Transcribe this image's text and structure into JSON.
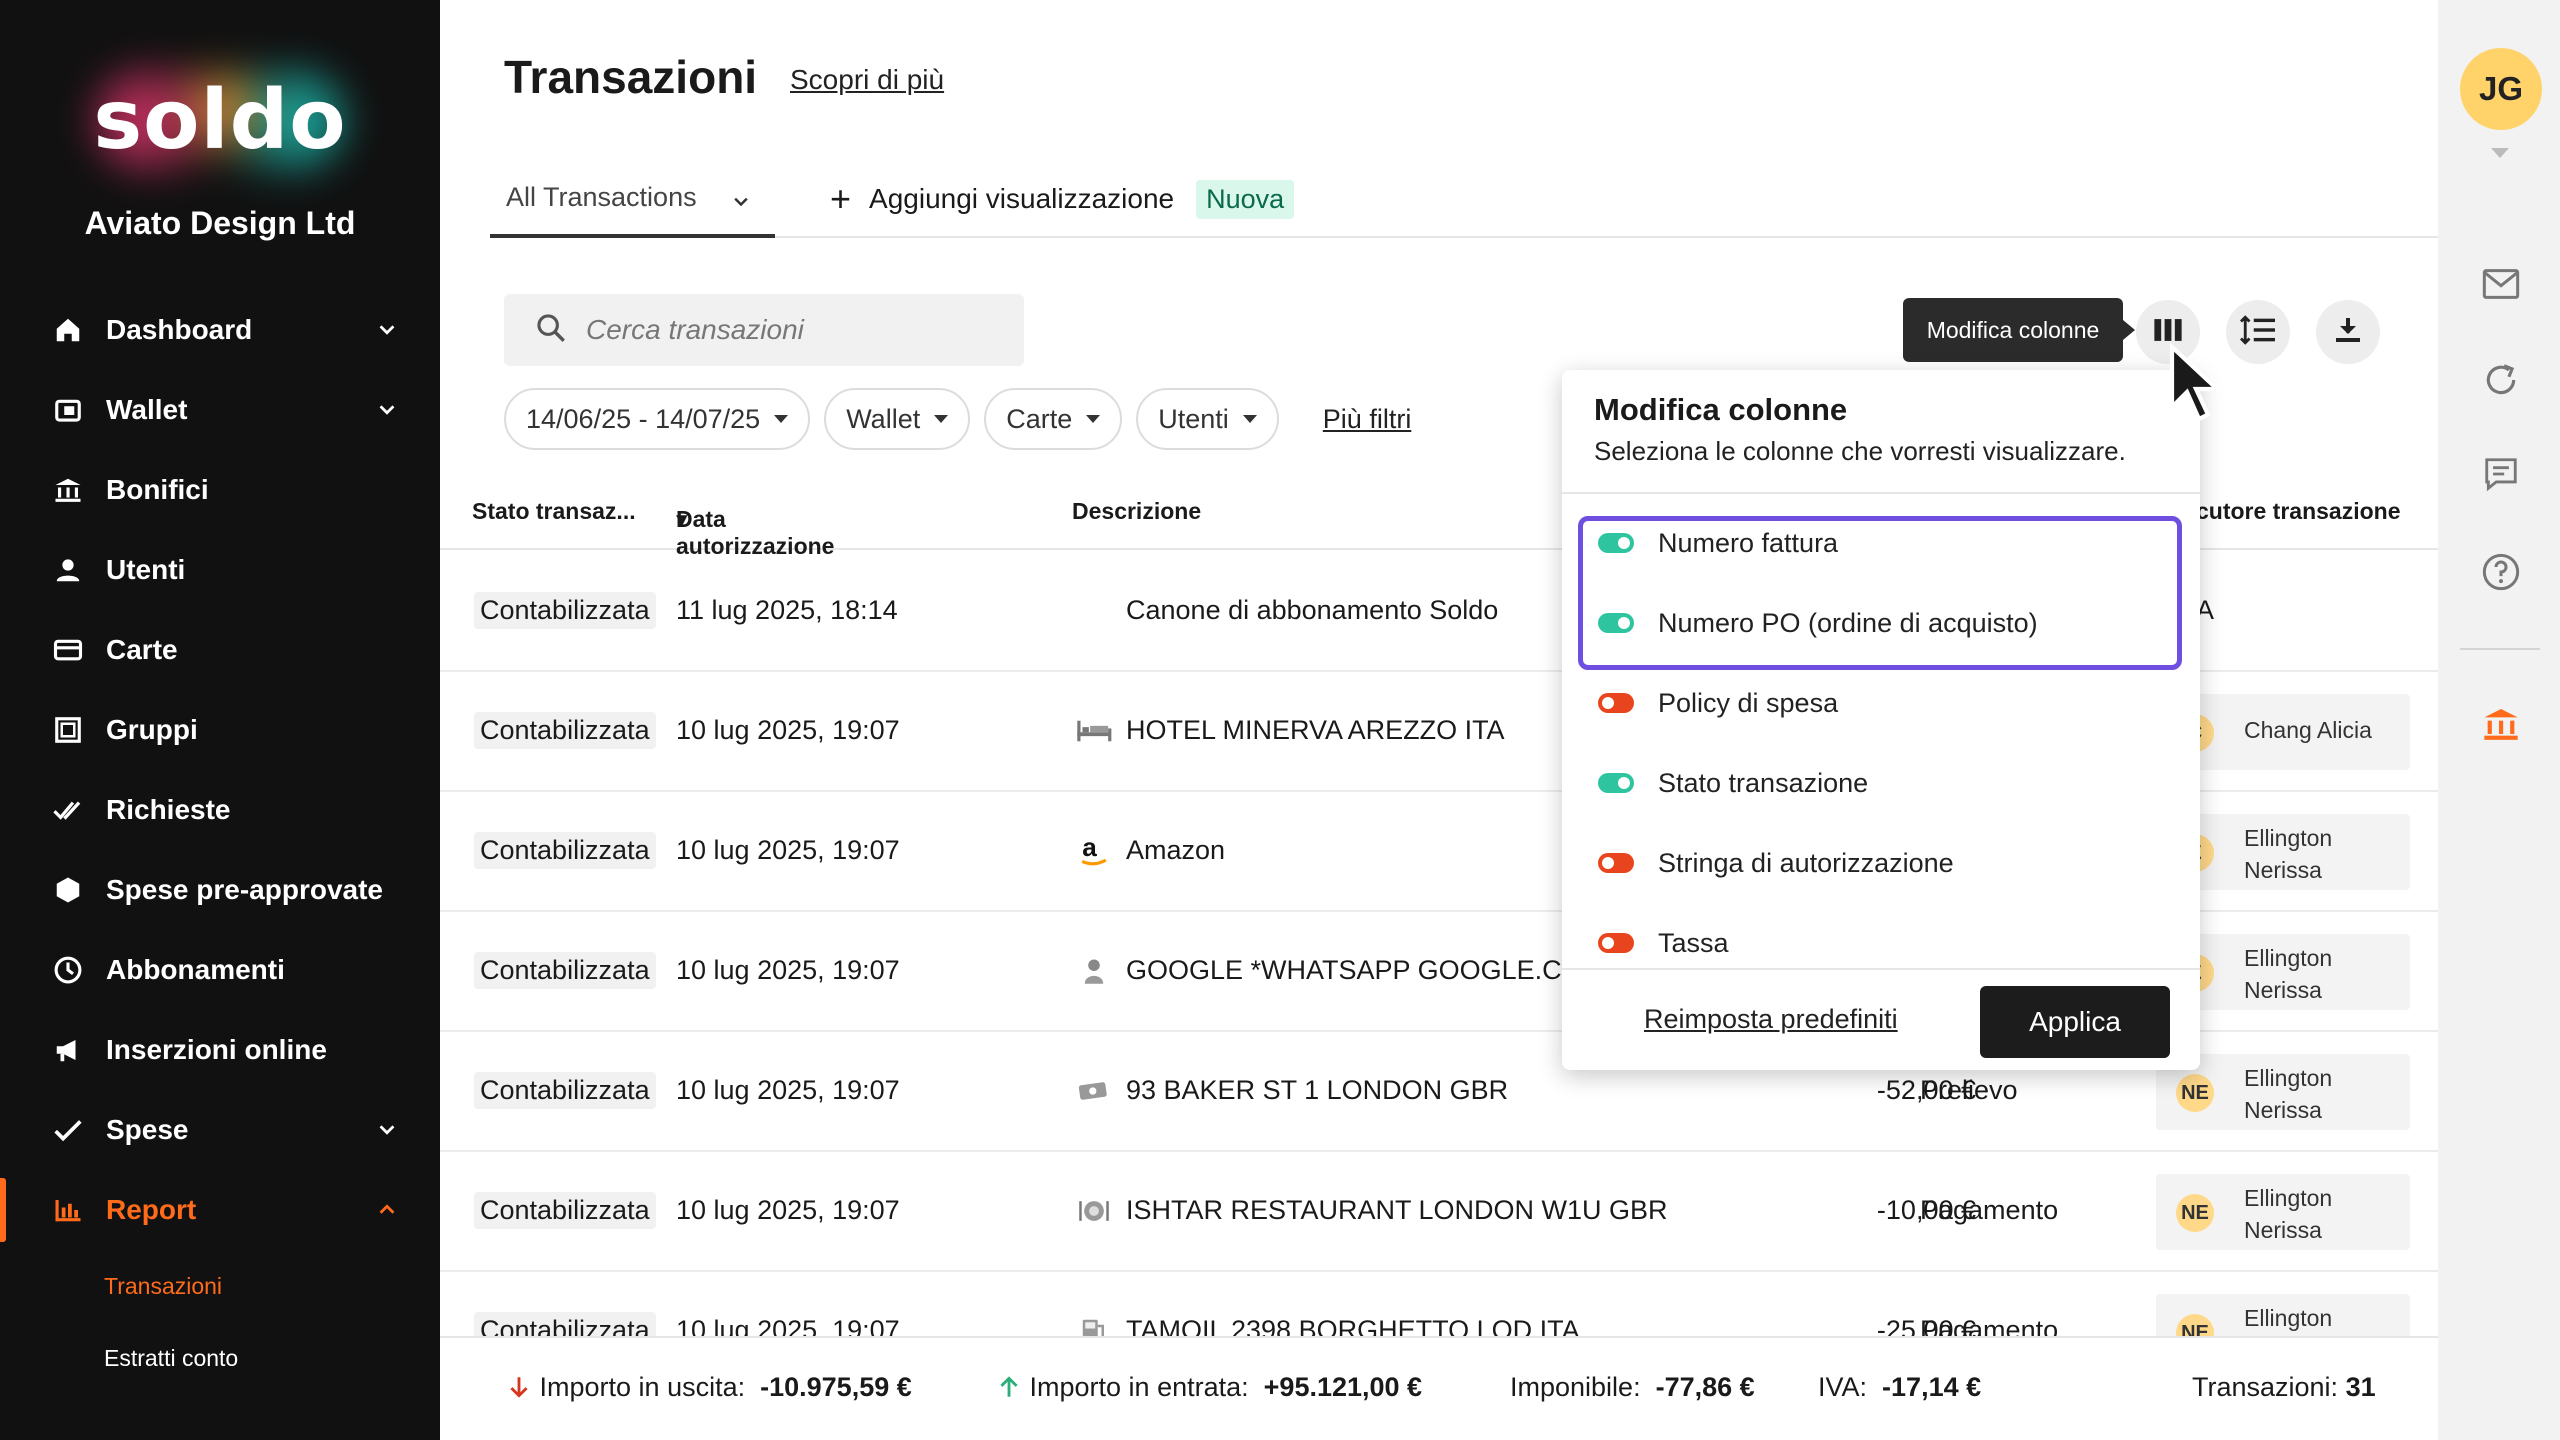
{
  "sidebar": {
    "logo_text": "soldo",
    "company": "Aviato Design Ltd",
    "items": [
      {
        "label": "Dashboard",
        "icon": "home-icon"
      },
      {
        "label": "Wallet",
        "icon": "wallet-icon"
      },
      {
        "label": "Bonifici",
        "icon": "bank-transfer-icon"
      },
      {
        "label": "Utenti",
        "icon": "user-icon"
      },
      {
        "label": "Carte",
        "icon": "card-icon"
      },
      {
        "label": "Gruppi",
        "icon": "groups-icon"
      },
      {
        "label": "Richieste",
        "icon": "requests-icon"
      },
      {
        "label": "Spese pre-approvate",
        "icon": "shield-icon"
      },
      {
        "label": "Abbonamenti",
        "icon": "clock-icon"
      },
      {
        "label": "Inserzioni online",
        "icon": "megaphone-icon"
      },
      {
        "label": "Spese",
        "icon": "check-icon"
      },
      {
        "label": "Report",
        "icon": "chart-icon"
      }
    ],
    "sub_items": [
      "Transazioni",
      "Estratti conto"
    ],
    "accent": "#ff6b1a"
  },
  "header": {
    "title": "Transazioni",
    "learn_more": "Scopri di più",
    "tab_all": "All Transactions",
    "add_view": "Aggiungi visualizzazione",
    "new_badge": "Nuova"
  },
  "search": {
    "placeholder": "Cerca transazioni"
  },
  "filters": {
    "date_range": "14/06/25 - 14/07/25",
    "wallet": "Wallet",
    "cards": "Carte",
    "users": "Utenti",
    "more": "Più filtri"
  },
  "toolbar": {
    "tooltip": "Modifica colonne"
  },
  "table": {
    "headers": {
      "status": "Stato transaz...",
      "date": "Data autorizzazione",
      "description": "Descrizione",
      "executor": "cutore transazione"
    },
    "rows": [
      {
        "status": "Contabilizzata",
        "date": "11 lug 2025, 18:14",
        "desc": "Canone di abbonamento Soldo",
        "amount": "",
        "type": "",
        "initials": "",
        "name": "A"
      },
      {
        "status": "Contabilizzata",
        "date": "10 lug 2025, 19:07",
        "desc": "HOTEL MINERVA AREZZO ITA",
        "amount": "",
        "type": "",
        "initials": "C",
        "name": "Chang Alicia"
      },
      {
        "status": "Contabilizzata",
        "date": "10 lug 2025, 19:07",
        "desc": "Amazon",
        "amount": "",
        "type": "",
        "initials": "E",
        "name": "Ellington Nerissa"
      },
      {
        "status": "Contabilizzata",
        "date": "10 lug 2025, 19:07",
        "desc": "GOOGLE *WHATSAPP GOOGLE.CON",
        "amount": "",
        "type": "",
        "initials": "E",
        "name": "Ellington Nerissa"
      },
      {
        "status": "Contabilizzata",
        "date": "10 lug 2025, 19:07",
        "desc": "93 BAKER ST 1 LONDON GBR",
        "amount": "-52,00 €",
        "type": "Prelievo",
        "initials": "NE",
        "name": "Ellington Nerissa"
      },
      {
        "status": "Contabilizzata",
        "date": "10 lug 2025, 19:07",
        "desc": "ISHTAR RESTAURANT LONDON W1U GBR",
        "amount": "-10,00 €",
        "type": "Pagamento",
        "initials": "NE",
        "name": "Ellington Nerissa"
      },
      {
        "status": "Contabilizzata",
        "date": "10 lug 2025, 19:07",
        "desc": "TAMOIL 2398 BORGHETTO LOD ITA",
        "amount": "-25,00 €",
        "type": "Pagamento",
        "initials": "NE",
        "name": "Ellington"
      }
    ]
  },
  "footer": {
    "out_label": "Importo in uscita:",
    "out_value": "-10.975,59 €",
    "in_label": "Importo in entrata:",
    "in_value": "+95.121,00 €",
    "taxable_label": "Imponibile:",
    "taxable_value": "-77,86 €",
    "vat_label": "IVA:",
    "vat_value": "-17,14 €",
    "count_label": "Transazioni:",
    "count_value": "31"
  },
  "popup": {
    "title": "Modifica colonne",
    "subtitle": "Seleziona le colonne che vorresti visualizzare.",
    "options": [
      {
        "label": "Numero fattura",
        "on": true
      },
      {
        "label": "Numero PO (ordine di acquisto)",
        "on": true
      },
      {
        "label": "Policy di spesa",
        "on": false
      },
      {
        "label": "Stato transazione",
        "on": true
      },
      {
        "label": "Stringa di autorizzazione",
        "on": false
      },
      {
        "label": "Tassa",
        "on": false
      }
    ],
    "reset": "Reimposta predefiniti",
    "apply": "Applica",
    "highlight_color": "#6f4fe0"
  },
  "rail": {
    "user_initials": "JG"
  }
}
